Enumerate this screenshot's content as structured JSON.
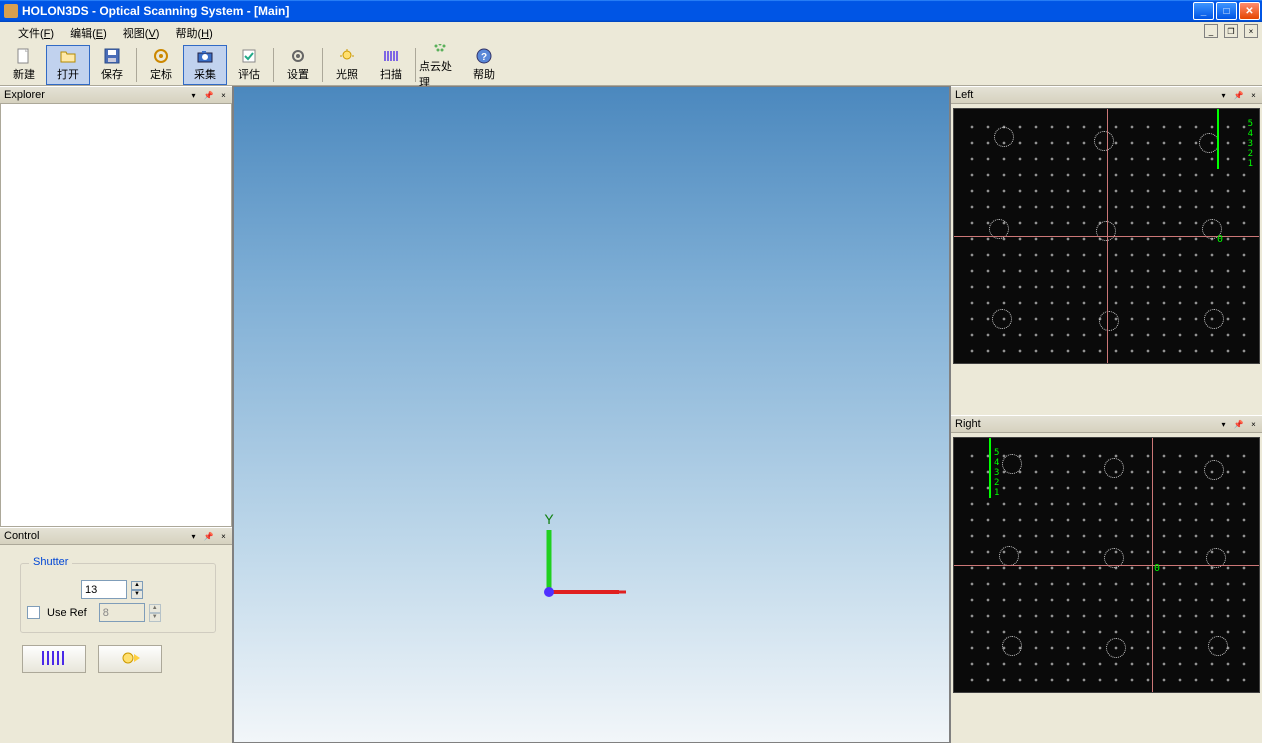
{
  "titlebar": {
    "title": "HOLON3DS - Optical Scanning System - [Main]"
  },
  "menubar": {
    "items": [
      {
        "label": "文件(F)",
        "key": "F"
      },
      {
        "label": "编辑(E)",
        "key": "E"
      },
      {
        "label": "视图(V)",
        "key": "V"
      },
      {
        "label": "帮助(H)",
        "key": "H"
      }
    ]
  },
  "toolbar": {
    "buttons": [
      {
        "name": "new",
        "label": "新建"
      },
      {
        "name": "open",
        "label": "打开"
      },
      {
        "name": "save",
        "label": "保存"
      },
      {
        "name": "sep"
      },
      {
        "name": "calib",
        "label": "定标"
      },
      {
        "name": "capture",
        "label": "采集"
      },
      {
        "name": "eval",
        "label": "评估"
      },
      {
        "name": "sep"
      },
      {
        "name": "setting",
        "label": "设置"
      },
      {
        "name": "sep"
      },
      {
        "name": "light",
        "label": "光照"
      },
      {
        "name": "scan",
        "label": "扫描"
      },
      {
        "name": "sep"
      },
      {
        "name": "cloud",
        "label": "点云处理"
      },
      {
        "name": "help",
        "label": "帮助"
      }
    ],
    "active": "capture"
  },
  "panels": {
    "explorer": {
      "title": "Explorer"
    },
    "control": {
      "title": "Control"
    },
    "left": {
      "title": "Left"
    },
    "right": {
      "title": "Right"
    }
  },
  "control": {
    "group_title": "Shutter",
    "shutter_value": "13",
    "use_ref_label": "Use Ref",
    "use_ref_checked": false,
    "ref_value": "8"
  },
  "viewport": {
    "axis_label_y": "Y"
  },
  "camera": {
    "tick_labels": [
      "5",
      "4",
      "3",
      "2",
      "1"
    ],
    "zero_label": "0"
  }
}
